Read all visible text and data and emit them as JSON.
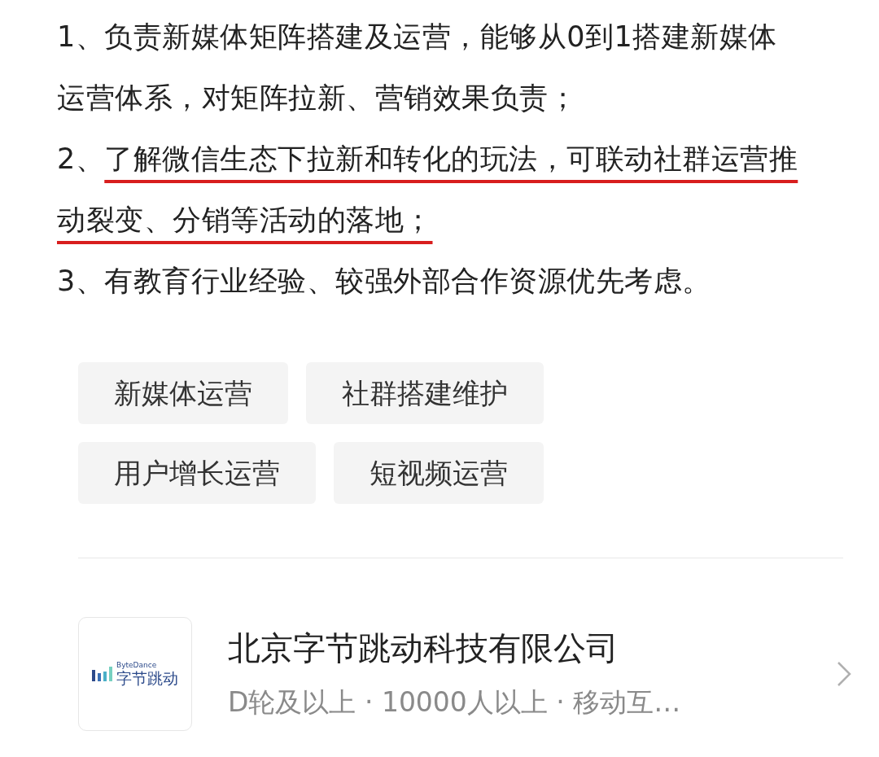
{
  "requirements": [
    {
      "number": "1、",
      "text": "负责新媒体矩阵搭建及运营，能够从0到1搭建新媒体运营体系，对矩阵拉新、营销效果负责；",
      "underlined": false
    },
    {
      "number": "2、",
      "text": "了解微信生态下拉新和转化的玩法，可联动社群运营推动裂变、分销等活动的落地；",
      "underlined": true
    },
    {
      "number": "3、",
      "text": "有教育行业经验、较强外部合作资源优先考虑。",
      "underlined": false
    }
  ],
  "tags": [
    "新媒体运营",
    "社群搭建维护",
    "用户增长运营",
    "短视频运营"
  ],
  "company": {
    "logo": {
      "caption": "ByteDance",
      "name": "字节跳动"
    },
    "name": "北京字节跳动科技有限公司",
    "details": "D轮及以上 · 10000人以上 · 移动互…"
  }
}
